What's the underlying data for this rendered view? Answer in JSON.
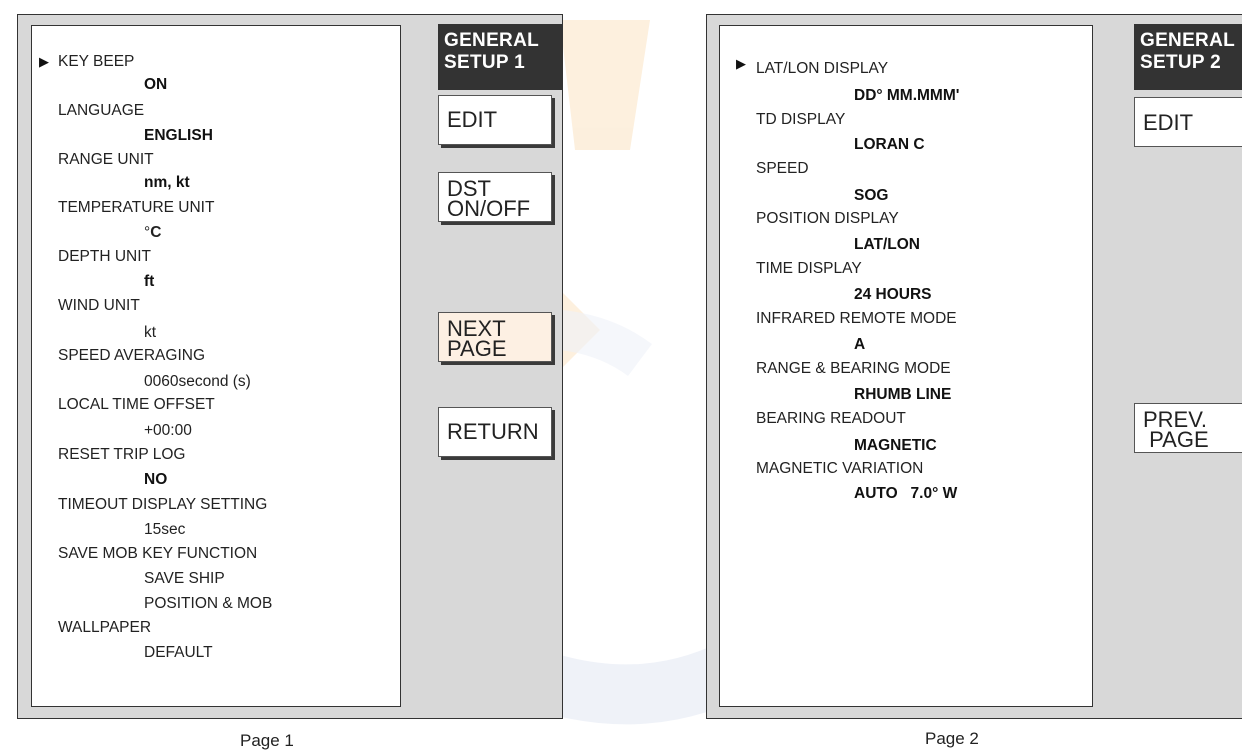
{
  "page1": {
    "title_line1": "GENERAL",
    "title_line2": "SETUP 1",
    "menu": [
      {
        "label": "KEY BEEP",
        "value": "ON",
        "bold": true
      },
      {
        "label": "LANGUAGE",
        "value": "ENGLISH",
        "bold": true
      },
      {
        "label": "RANGE UNIT",
        "value": "nm, kt",
        "bold": true
      },
      {
        "label": "TEMPERATURE UNIT",
        "value_prefix": "°",
        "value": "C",
        "bold": true
      },
      {
        "label": "DEPTH UNIT",
        "value": "ft",
        "bold": true
      },
      {
        "label": "WIND UNIT",
        "value": "kt",
        "bold": false
      },
      {
        "label": "SPEED AVERAGING",
        "value": "0060second (s)",
        "bold": false
      },
      {
        "label": "LOCAL TIME OFFSET",
        "value": "+00:00",
        "bold": false
      },
      {
        "label": "RESET TRIP LOG",
        "value": "NO",
        "bold": true
      },
      {
        "label": "TIMEOUT DISPLAY SETTING",
        "value": "15sec",
        "bold": false
      },
      {
        "label": "SAVE MOB KEY FUNCTION",
        "value": "SAVE SHIP",
        "value2": "POSITION & MOB",
        "bold": false
      },
      {
        "label": "WALLPAPER",
        "value": "DEFAULT",
        "bold": false
      }
    ],
    "softkeys": {
      "edit": "EDIT",
      "dst_line1": "DST",
      "dst_line2": "ON/OFF",
      "next_line1": "NEXT",
      "next_line2": "PAGE",
      "return": "RETURN"
    },
    "caption": "Page 1"
  },
  "page2": {
    "title_line1": "GENERAL",
    "title_line2": "SETUP 2",
    "menu": [
      {
        "label": "LAT/LON DISPLAY",
        "value": "DD° MM.MMM'",
        "bold": true
      },
      {
        "label": "TD DISPLAY",
        "value": "LORAN C",
        "bold": true
      },
      {
        "label": "SPEED",
        "value": "SOG",
        "bold": true
      },
      {
        "label": "POSITION DISPLAY",
        "value": "LAT/LON",
        "bold": true
      },
      {
        "label": "TIME DISPLAY",
        "value": "24 HOURS",
        "bold": true
      },
      {
        "label": "INFRARED REMOTE MODE",
        "value": "A",
        "bold": true
      },
      {
        "label": "RANGE & BEARING MODE",
        "value": "RHUMB LINE",
        "bold": true
      },
      {
        "label": "BEARING READOUT",
        "value": "MAGNETIC",
        "bold": true
      },
      {
        "label": "MAGNETIC VARIATION",
        "value": "AUTO   7.0° W",
        "bold": true
      }
    ],
    "softkeys": {
      "edit": "EDIT",
      "prev_line1": "PREV.",
      "prev_line2": " PAGE"
    },
    "caption": "Page 2"
  },
  "cursor_glyph": "▶",
  "colors": {
    "screen_bg": "#d8d8d8",
    "title_bg": "#333333",
    "watermark_blue": "#e3e8f4",
    "watermark_orange": "#fbe3c2"
  }
}
